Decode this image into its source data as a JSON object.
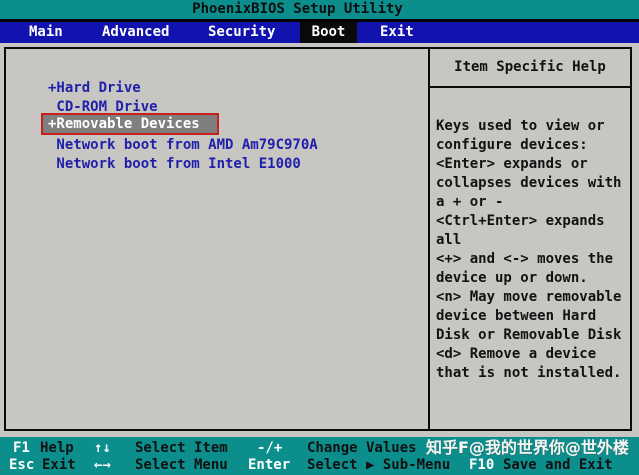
{
  "window": {
    "title": "PhoenixBIOS Setup Utility"
  },
  "menu": {
    "items": [
      {
        "label": "Main",
        "selected": false
      },
      {
        "label": "Advanced",
        "selected": false
      },
      {
        "label": "Security",
        "selected": false
      },
      {
        "label": "Boot",
        "selected": true
      },
      {
        "label": "Exit",
        "selected": false
      }
    ]
  },
  "boot": {
    "items": [
      {
        "label": "+Hard Drive",
        "selected": false
      },
      {
        "label": " CD-ROM Drive",
        "selected": false
      },
      {
        "label": "+Removable Devices",
        "selected": true,
        "annotated": true
      },
      {
        "label": " Network boot from AMD Am79C970A",
        "selected": false
      },
      {
        "label": " Network boot from Intel E1000",
        "selected": false
      }
    ]
  },
  "help": {
    "title": "Item Specific Help",
    "lines": [
      "Keys used to view or",
      "configure devices:",
      "<Enter> expands or",
      "collapses devices with",
      "a + or -",
      "<Ctrl+Enter> expands",
      "all",
      "<+> and <-> moves the",
      "device up or down.",
      "<n> May move removable",
      "device between Hard",
      "Disk or Removable Disk",
      "<d> Remove a device",
      "that is not installed."
    ]
  },
  "footer": {
    "rows": [
      {
        "entries": [
          {
            "key": "F1",
            "label": "Help"
          },
          {
            "key": "↑↓",
            "label": "Select Item"
          },
          {
            "key": "-/+",
            "label": "Change Values"
          }
        ]
      },
      {
        "entries": [
          {
            "key": "Esc",
            "label": "Exit"
          },
          {
            "key": "←→",
            "label": "Select Menu"
          },
          {
            "key": "Enter",
            "label": "Select ▶ Sub-Menu"
          },
          {
            "key": "F10",
            "label": "Save and Exit"
          }
        ]
      }
    ],
    "watermark": "知乎F@我的世界你@世外楼"
  },
  "colors": {
    "teal": "#0b8e8c",
    "menu_blue": "#1212ae",
    "selected_tab_bg": "#0a0a0a",
    "body_gray": "#c7c6c2",
    "item_blue": "#2020aa",
    "highlight_bg": "#7f7f7f",
    "highlight_text": "#ffffff",
    "annotation_red": "#c4211f",
    "text_black": "#121212"
  }
}
